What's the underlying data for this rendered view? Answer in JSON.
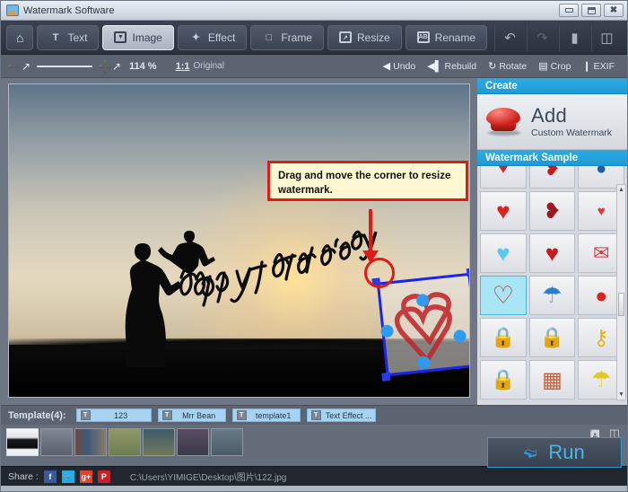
{
  "window": {
    "title": "Watermark Software",
    "icon": "app-icon",
    "controls": [
      {
        "name": "minimize",
        "glyph": "min"
      },
      {
        "name": "maximize",
        "glyph": "max"
      },
      {
        "name": "close",
        "glyph": "✕"
      }
    ]
  },
  "tabs": [
    {
      "id": "home",
      "label": "",
      "icon": "⌂",
      "active": false
    },
    {
      "id": "text",
      "label": "Text",
      "icon": "T",
      "active": false
    },
    {
      "id": "image",
      "label": "Image",
      "icon": "⬇",
      "active": true
    },
    {
      "id": "effect",
      "label": "Effect",
      "icon": "✦",
      "active": false
    },
    {
      "id": "frame",
      "label": "Frame",
      "icon": "□",
      "active": false
    },
    {
      "id": "resize",
      "label": "Resize",
      "icon": "⤡",
      "active": false
    },
    {
      "id": "rename",
      "label": "Rename",
      "icon": "AB",
      "active": false
    }
  ],
  "titlebar_tools": [
    {
      "name": "undo-icon",
      "glyph": "↺"
    },
    {
      "name": "redo-icon",
      "glyph": "↷"
    },
    {
      "name": "comment-icon",
      "glyph": "▤"
    },
    {
      "name": "register-icon",
      "glyph": "▥"
    }
  ],
  "zoombar": {
    "zoom_out_icon": "⊖",
    "zoom_in_icon": "⊕",
    "percent": "114 %",
    "original_ratio": "1:1",
    "original_label": "Original",
    "actions": [
      {
        "name": "undo",
        "label": "Undo",
        "glyph": "◀"
      },
      {
        "name": "rebuild",
        "label": "Rebuild",
        "glyph": "◀‖"
      },
      {
        "name": "rotate",
        "label": "Rotate",
        "glyph": "↻"
      },
      {
        "name": "crop",
        "label": "Crop",
        "glyph": "▤"
      },
      {
        "name": "exif",
        "label": "EXIF",
        "glyph": "❙"
      }
    ]
  },
  "callout": {
    "text": "Drag and move the corner to resize watermark."
  },
  "canvas": {
    "photo_caption": "happy father's day"
  },
  "right_panel": {
    "create_header": "Create",
    "add_title": "Add",
    "add_subtitle": "Custom Watermark",
    "sample_header": "Watermark Sample",
    "samples": [
      {
        "name": "heart-small-red",
        "glyph": "♥",
        "color": "#d81f26",
        "selected": false
      },
      {
        "name": "heart-ribbon-red",
        "glyph": "❥",
        "color": "#c5181f",
        "selected": false
      },
      {
        "name": "ring-blue",
        "glyph": "●",
        "color": "#1b5fa8",
        "selected": false
      },
      {
        "name": "heart-glossy-red",
        "glyph": "♥",
        "color": "#e02121",
        "selected": false
      },
      {
        "name": "heart-arrow",
        "glyph": "❥",
        "color": "#9c1a1f",
        "selected": false
      },
      {
        "name": "heart-wings",
        "glyph": "♥",
        "color": "#e0353b",
        "selected": false
      },
      {
        "name": "heart-blue-glitter",
        "glyph": "♥",
        "color": "#5bc8f0",
        "selected": false
      },
      {
        "name": "i-love-you-heart",
        "glyph": "♥",
        "color": "#c61a22",
        "selected": false
      },
      {
        "name": "love-letter",
        "glyph": "✉",
        "color": "#e23b3f",
        "selected": false
      },
      {
        "name": "heart-brush-red",
        "glyph": "♡",
        "color": "#c0262a",
        "selected": true
      },
      {
        "name": "umbrella-blue",
        "glyph": "☂",
        "color": "#2f7fd0",
        "selected": false
      },
      {
        "name": "stamp-red",
        "glyph": "●",
        "color": "#d62420",
        "selected": false
      },
      {
        "name": "padlock-gold",
        "glyph": "🔒",
        "color": "#e0a832",
        "selected": false
      },
      {
        "name": "lock-blue",
        "glyph": "🔒",
        "color": "#1b8fd6",
        "selected": false
      },
      {
        "name": "key-gold",
        "glyph": "⚷",
        "color": "#e8b41d",
        "selected": false
      },
      {
        "name": "padlock-silver",
        "glyph": "🔒",
        "color": "#b8bcc2",
        "selected": false
      },
      {
        "name": "brick-wall",
        "glyph": "▦",
        "color": "#c2603a",
        "selected": false
      },
      {
        "name": "umbrella-redyellow",
        "glyph": "☂",
        "color": "#e8c52a",
        "selected": false
      }
    ]
  },
  "template_bar": {
    "label": "Template(4):",
    "items": [
      {
        "name": "template-123",
        "label": "123",
        "icon": "T"
      },
      {
        "name": "template-mrr-bean",
        "label": "Mrr Bean",
        "icon": "T"
      },
      {
        "name": "template-template1",
        "label": "template1",
        "icon": "T"
      },
      {
        "name": "template-text-effect",
        "label": "Text Effect ...",
        "icon": "T"
      }
    ]
  },
  "bottom": {
    "thumbnails": [
      {
        "name": "thumb-1",
        "selected": true
      },
      {
        "name": "thumb-2",
        "selected": false
      },
      {
        "name": "thumb-3",
        "selected": false
      },
      {
        "name": "thumb-4",
        "selected": false
      },
      {
        "name": "thumb-5",
        "selected": false
      },
      {
        "name": "thumb-6",
        "selected": false
      },
      {
        "name": "thumb-7",
        "selected": false
      }
    ],
    "save_icon": "▤",
    "save_as_icon": "▥",
    "run_label": "Run",
    "run_icon": "❱"
  },
  "status": {
    "share_label": "Share :",
    "socials": [
      {
        "name": "facebook-icon",
        "glyph": "f",
        "class": "fb"
      },
      {
        "name": "twitter-icon",
        "glyph": "ᵗ",
        "class": "tw"
      },
      {
        "name": "googleplus-icon",
        "glyph": "g+",
        "class": "gp"
      },
      {
        "name": "pinterest-icon",
        "glyph": "P",
        "class": "pi"
      }
    ],
    "path": "C:\\Users\\YIMIGE\\Desktop\\图片\\122.jpg"
  },
  "colors": {
    "accent_blue": "#2fa9e0",
    "run_blue": "#45b8ea",
    "callout_bg": "#fdf8d2",
    "callout_border": "#e01a14",
    "selection_blue": "#1b24e8",
    "handle_blue": "#2f9bf0"
  }
}
